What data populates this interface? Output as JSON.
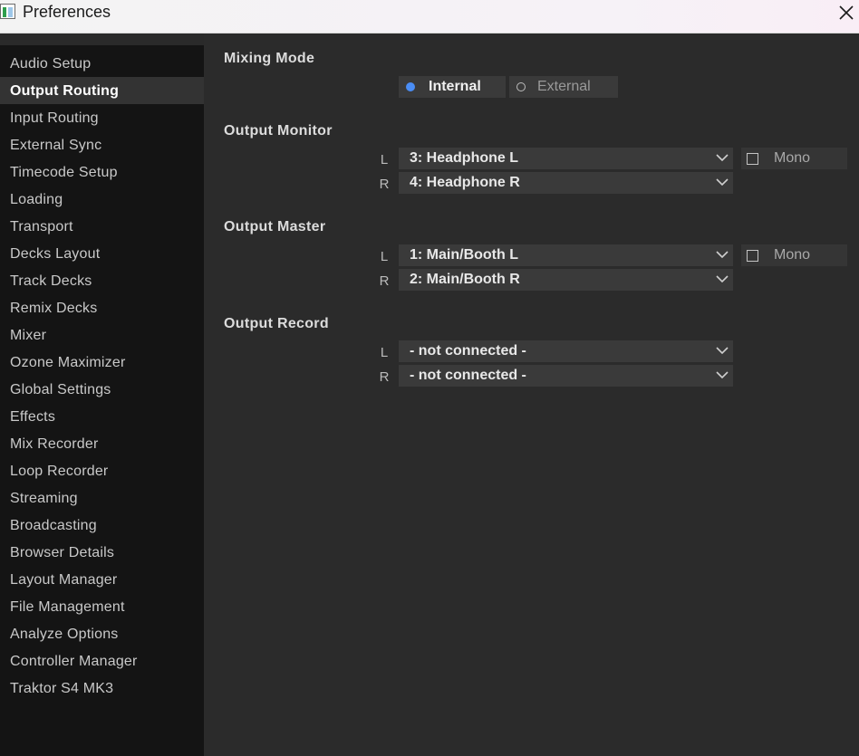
{
  "window": {
    "title": "Preferences"
  },
  "sidebar": {
    "items": [
      {
        "label": "Audio Setup",
        "active": false
      },
      {
        "label": "Output Routing",
        "active": true
      },
      {
        "label": "Input Routing",
        "active": false
      },
      {
        "label": "External Sync",
        "active": false
      },
      {
        "label": "Timecode Setup",
        "active": false
      },
      {
        "label": "Loading",
        "active": false
      },
      {
        "label": "Transport",
        "active": false
      },
      {
        "label": "Decks Layout",
        "active": false
      },
      {
        "label": "Track Decks",
        "active": false
      },
      {
        "label": "Remix Decks",
        "active": false
      },
      {
        "label": "Mixer",
        "active": false
      },
      {
        "label": "Ozone Maximizer",
        "active": false
      },
      {
        "label": "Global Settings",
        "active": false
      },
      {
        "label": "Effects",
        "active": false
      },
      {
        "label": "Mix Recorder",
        "active": false
      },
      {
        "label": "Loop Recorder",
        "active": false
      },
      {
        "label": "Streaming",
        "active": false
      },
      {
        "label": "Broadcasting",
        "active": false
      },
      {
        "label": "Browser Details",
        "active": false
      },
      {
        "label": "Layout Manager",
        "active": false
      },
      {
        "label": "File Management",
        "active": false
      },
      {
        "label": "Analyze Options",
        "active": false
      },
      {
        "label": "Controller Manager",
        "active": false
      },
      {
        "label": "Traktor S4 MK3",
        "active": false
      }
    ]
  },
  "mixing_mode": {
    "title": "Mixing Mode",
    "internal": "Internal",
    "external": "External",
    "selected": "Internal"
  },
  "output_monitor": {
    "title": "Output Monitor",
    "left_label": "L",
    "right_label": "R",
    "left": "3: Headphone L",
    "right": "4: Headphone R",
    "mono_label": "Mono",
    "mono_checked": false
  },
  "output_master": {
    "title": "Output Master",
    "left_label": "L",
    "right_label": "R",
    "left": "1: Main/Booth L",
    "right": "2: Main/Booth R",
    "mono_label": "Mono",
    "mono_checked": false
  },
  "output_record": {
    "title": "Output Record",
    "left_label": "L",
    "right_label": "R",
    "left": "- not connected -",
    "right": "- not connected -"
  },
  "colors": {
    "accent": "#4a8df5",
    "panel": "#2b2b2b",
    "sidebar": "#141414",
    "control": "#3a3a3a"
  },
  "icons": {
    "app": "traktor-app-icon",
    "close": "close-icon",
    "dropdown": "chevron-down-icon"
  }
}
